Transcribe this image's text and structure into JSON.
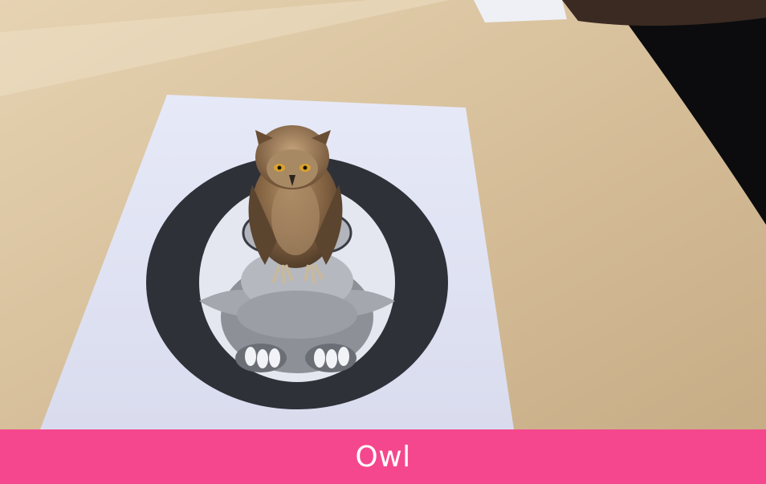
{
  "caption": {
    "text": "Owl",
    "bar_color": "#f5478d",
    "text_color": "#ffffff"
  },
  "scene": {
    "table_color": "#d8c29f",
    "paper_color": "#dfe3f3",
    "marker_ring_color": "#2f3139",
    "owl_model_color": "#8b6b4a",
    "icons": [
      "owl-marker-icon",
      "owl-3d-model-icon"
    ]
  }
}
